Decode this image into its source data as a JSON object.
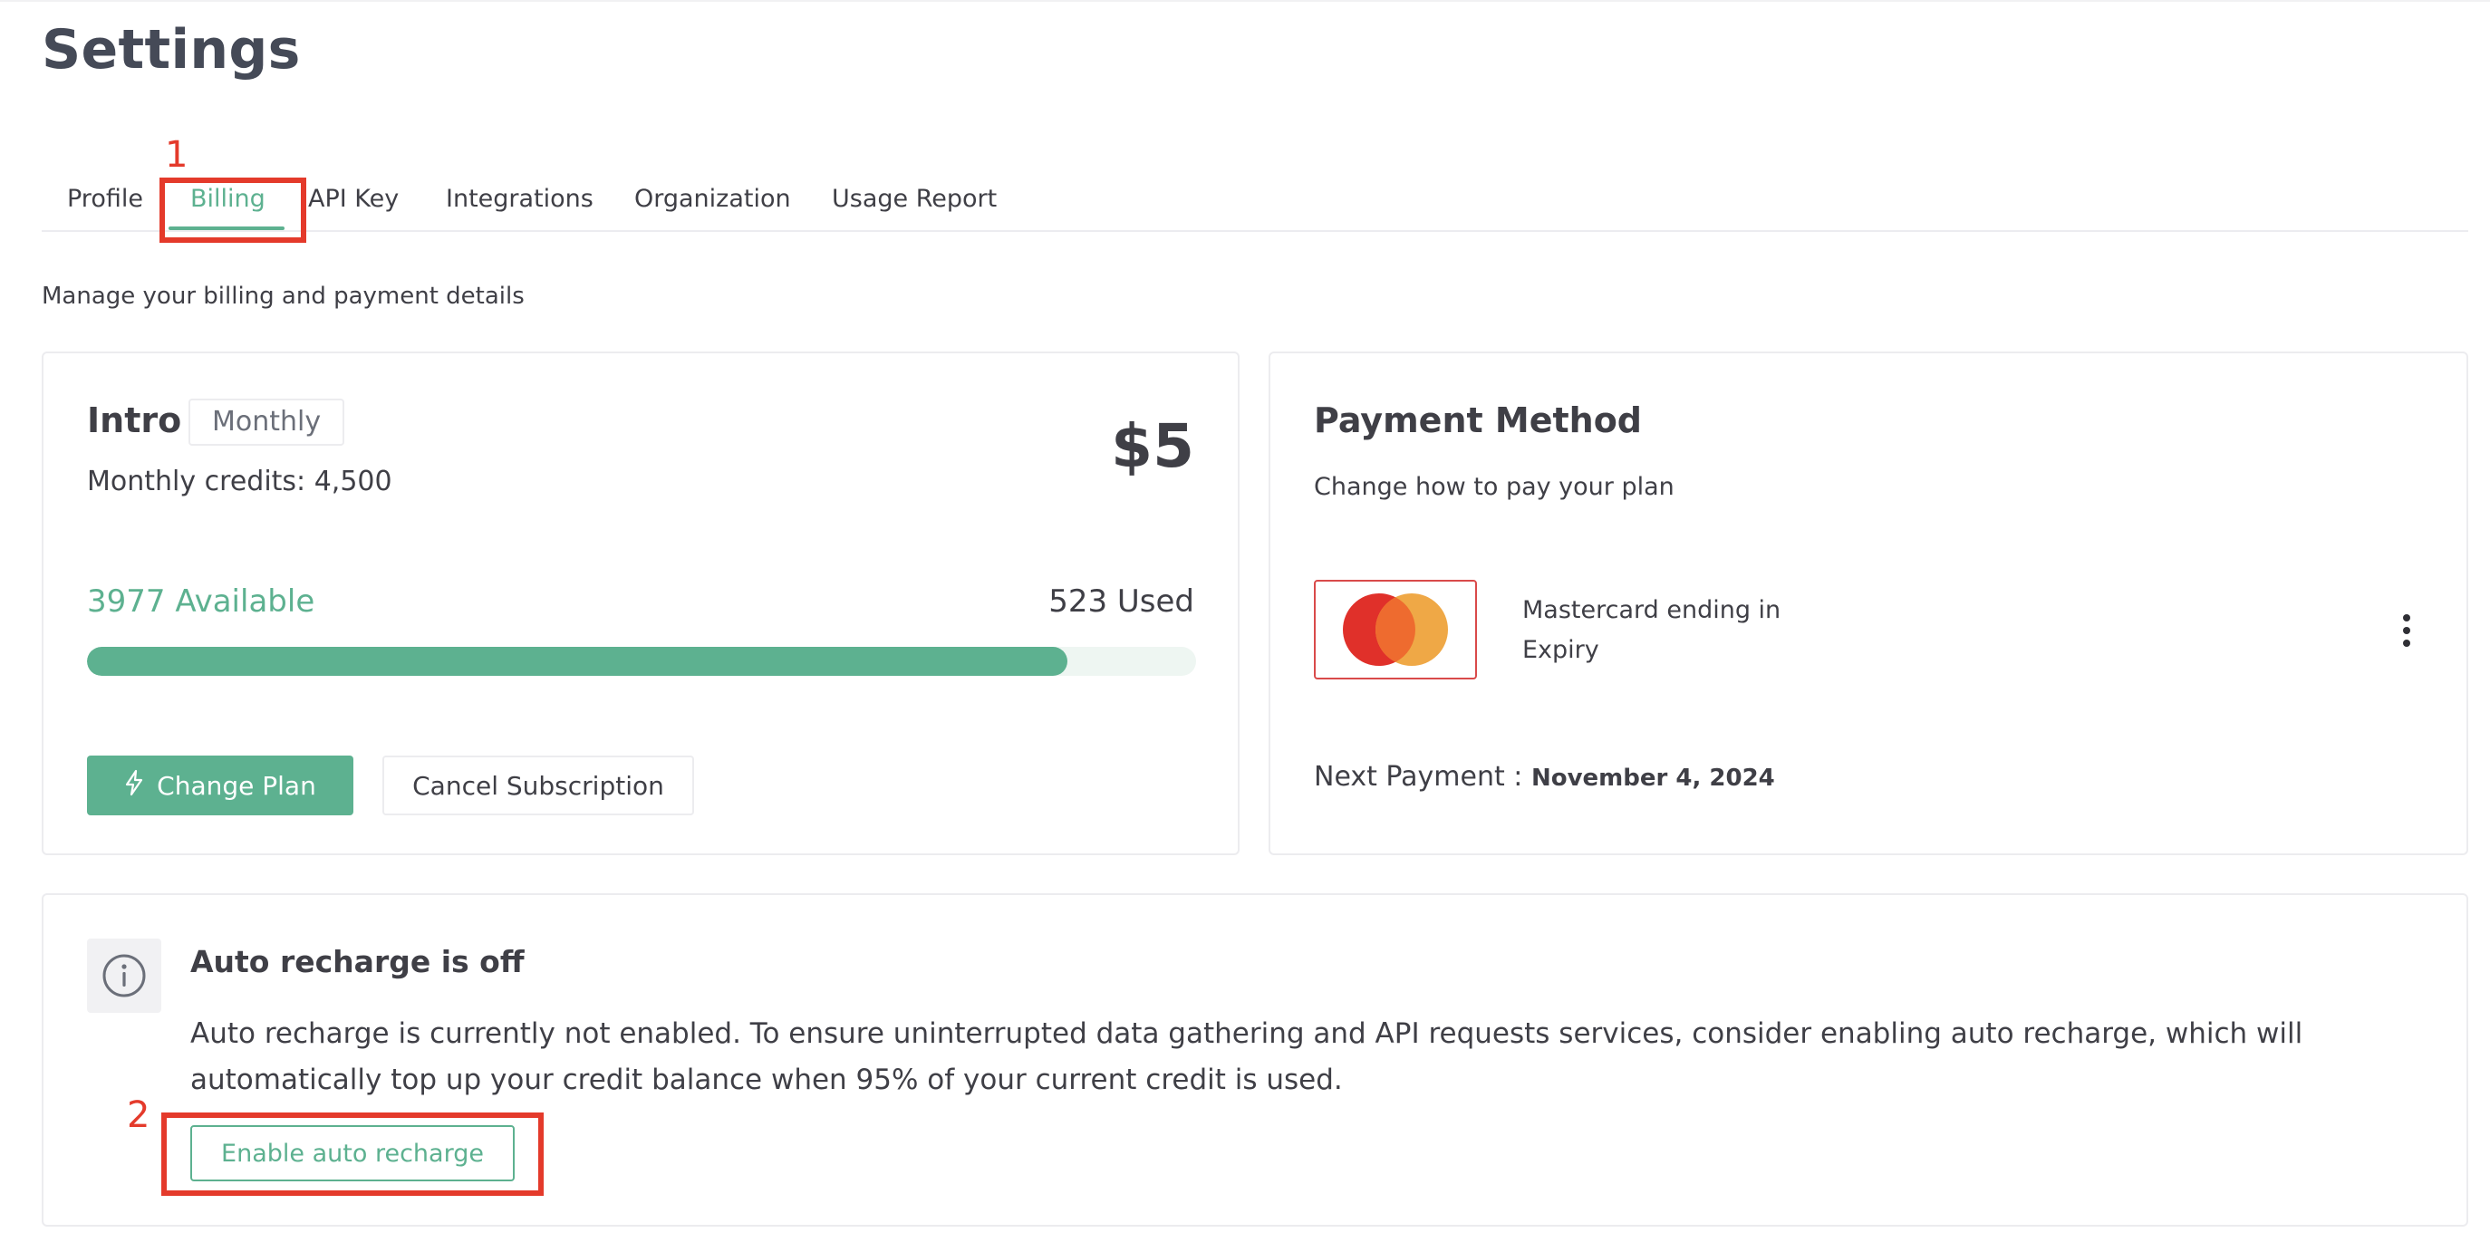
{
  "page": {
    "title": "Settings",
    "subtitle": "Manage your billing and payment details"
  },
  "tabs": [
    {
      "label": "Profile",
      "active": false
    },
    {
      "label": "Billing",
      "active": true
    },
    {
      "label": "API Key",
      "active": false
    },
    {
      "label": "Integrations",
      "active": false
    },
    {
      "label": "Organization",
      "active": false
    },
    {
      "label": "Usage Report",
      "active": false
    }
  ],
  "plan": {
    "name": "Intro",
    "period": "Monthly",
    "price": "$5",
    "credits_text": "Monthly credits: 4,500",
    "available_text": "3977 Available",
    "used_text": "523 Used",
    "usage_fraction": 0.8838,
    "change_plan_label": "Change Plan",
    "change_plan_icon": "lightning-icon",
    "cancel_label": "Cancel Subscription"
  },
  "payment": {
    "title": "Payment Method",
    "subtitle": "Change how to pay your plan",
    "card_brand_icon": "mastercard-icon",
    "card_line1": "Mastercard ending in",
    "card_line2": "Expiry",
    "next_payment_label": "Next Payment :",
    "next_payment_date": "November 4, 2024"
  },
  "recharge": {
    "title": "Auto recharge is off",
    "description": "Auto recharge is currently not enabled. To ensure uninterrupted data gathering and API requests services, consider enabling auto recharge, which will automatically top up your credit balance when 95% of your current credit is used.",
    "button_label": "Enable auto recharge",
    "icon": "info-icon"
  },
  "annotations": [
    {
      "label": "1"
    },
    {
      "label": "2"
    }
  ],
  "colors": {
    "accent": "#5db190",
    "annotation": "#e43a2b",
    "mastercard_red": "#e0302a",
    "mastercard_orange": "#eea33c",
    "text": "#3f3f46"
  }
}
